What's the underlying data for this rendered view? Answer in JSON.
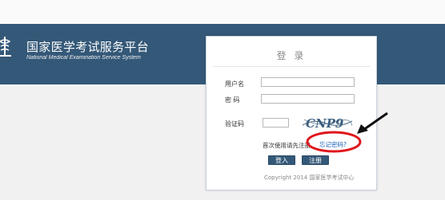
{
  "header": {
    "title_cn": "国家医学考试服务平台",
    "title_en": "National Medical Examination Service System",
    "logo_icon": "caduceus-logo-icon"
  },
  "login": {
    "title": "登 录",
    "username_label": "用户名",
    "password_label": "密 码",
    "captcha_label": "验证码",
    "captcha_text": "CNP9",
    "first_time_text": "首次使用请先注册",
    "forgot_link": "忘记密码?",
    "login_button": "登入",
    "register_button": "注册",
    "copyright": "Copyright 2014 国家医学考试中心"
  },
  "annotation": {
    "color": "#e0151b"
  }
}
